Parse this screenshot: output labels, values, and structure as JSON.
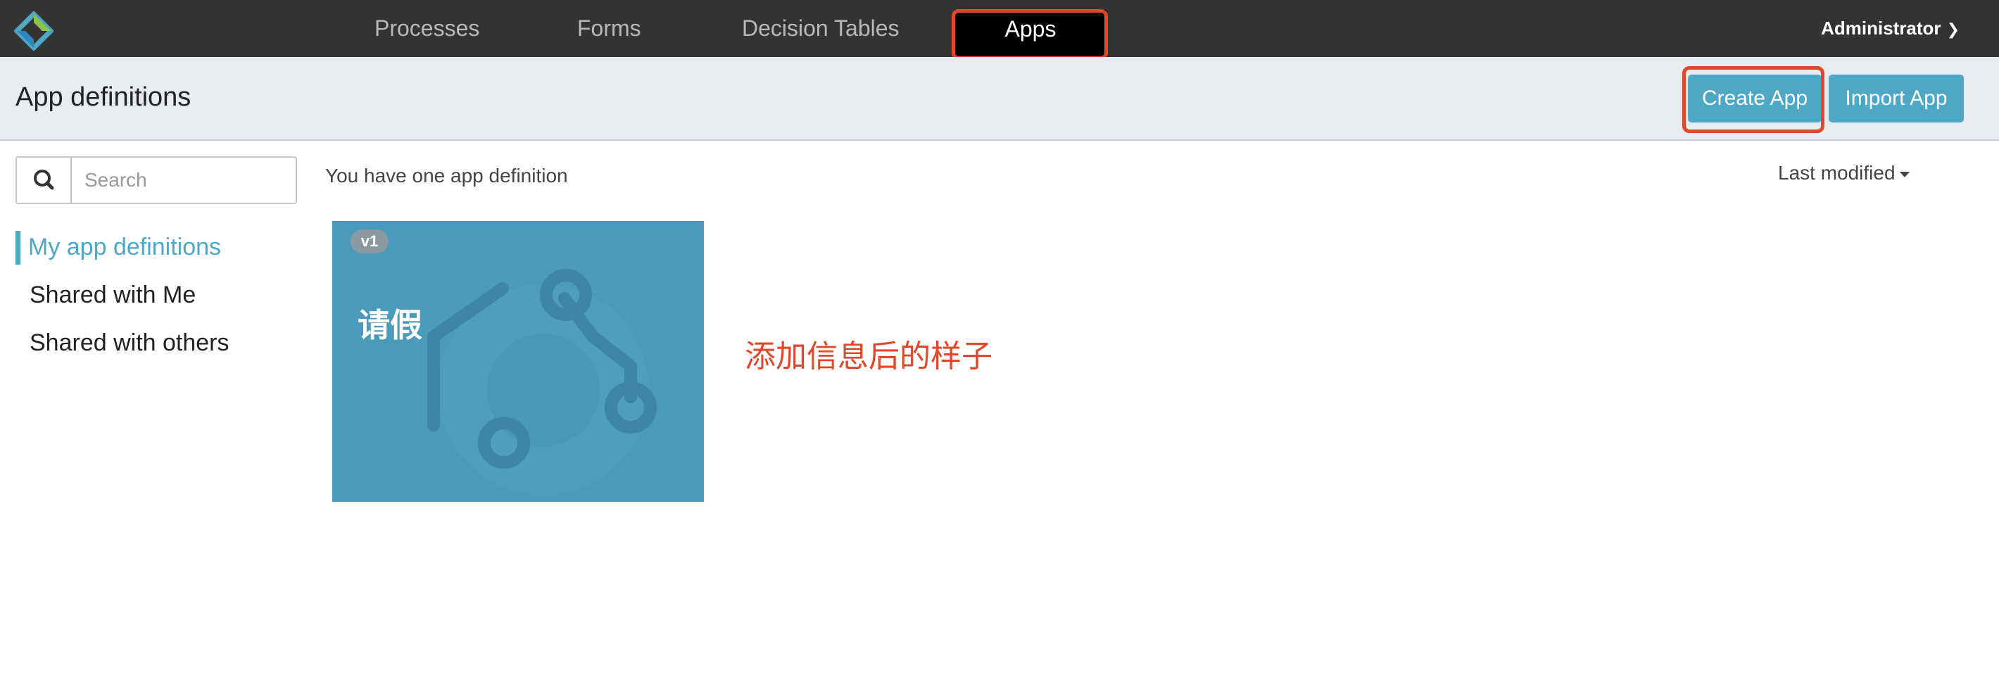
{
  "nav": {
    "items": [
      "Processes",
      "Forms",
      "Decision Tables",
      "Apps"
    ],
    "active": "Apps",
    "user": "Administrator"
  },
  "header": {
    "title": "App definitions",
    "create_label": "Create App",
    "import_label": "Import App"
  },
  "sidebar": {
    "search_placeholder": "Search",
    "items": [
      "My app definitions",
      "Shared with Me",
      "Shared with others"
    ]
  },
  "content": {
    "summary": "You have one app definition",
    "sort_label": "Last modified",
    "apps": [
      {
        "version": "v1",
        "name": "请假"
      }
    ],
    "annotation": "添加信息后的样子"
  },
  "colors": {
    "accent": "#4ea7c5",
    "navbar": "#333333",
    "highlight": "#e2472a",
    "card": "#4a9abb"
  }
}
